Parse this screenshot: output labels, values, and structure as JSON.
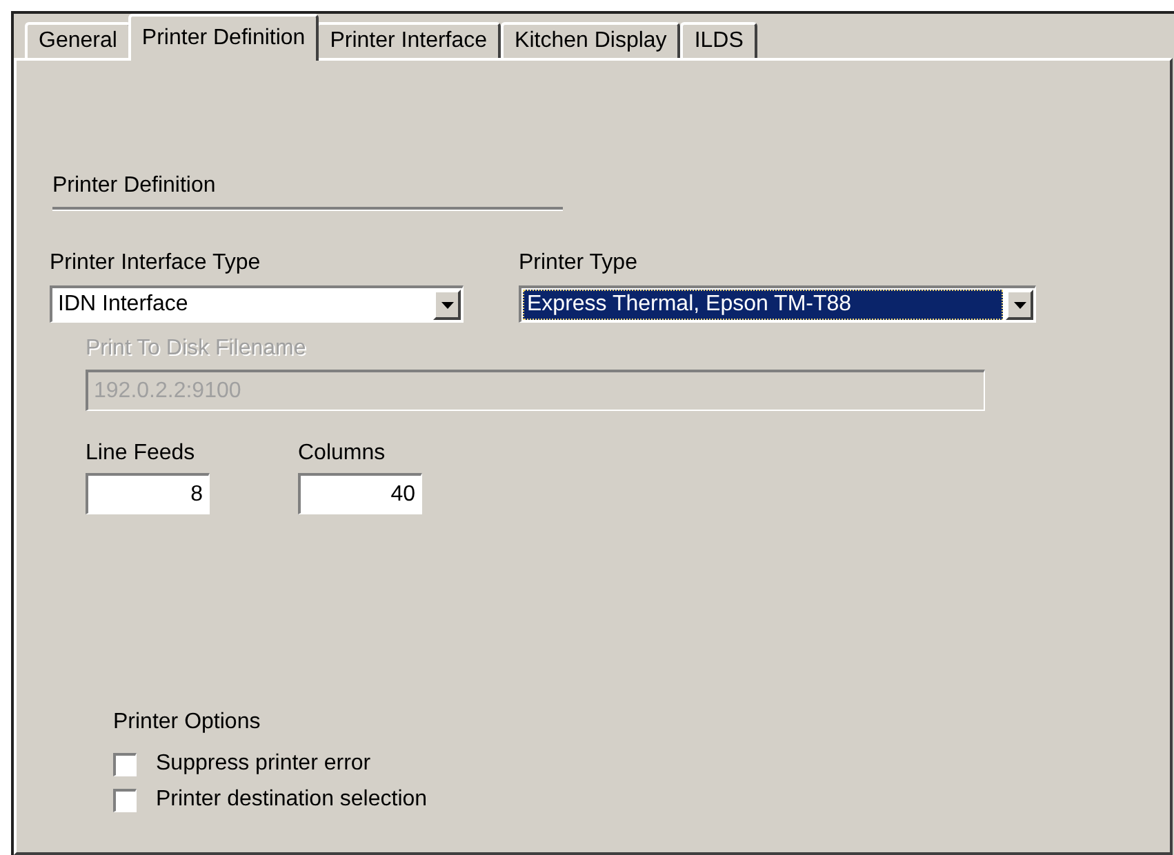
{
  "tabs": [
    {
      "label": "General",
      "selected": false
    },
    {
      "label": "Printer Definition",
      "selected": true
    },
    {
      "label": "Printer Interface",
      "selected": false
    },
    {
      "label": "Kitchen Display",
      "selected": false
    },
    {
      "label": "ILDS",
      "selected": false
    }
  ],
  "section_title": "Printer Definition",
  "printer_interface_type": {
    "label": "Printer Interface Type",
    "value": "IDN Interface",
    "focused": false
  },
  "printer_type": {
    "label": "Printer Type",
    "value": "Express Thermal, Epson TM-T88",
    "focused": true
  },
  "print_to_disk_filename": {
    "label": "Print To Disk Filename",
    "value": "192.0.2.2:9100",
    "disabled": true
  },
  "line_feeds": {
    "label": "Line Feeds",
    "value": "8"
  },
  "columns": {
    "label": "Columns",
    "value": "40"
  },
  "printer_options": {
    "title": "Printer Options",
    "items": [
      {
        "label": "Suppress printer error",
        "checked": false
      },
      {
        "label": "Printer destination selection",
        "checked": false
      }
    ]
  }
}
